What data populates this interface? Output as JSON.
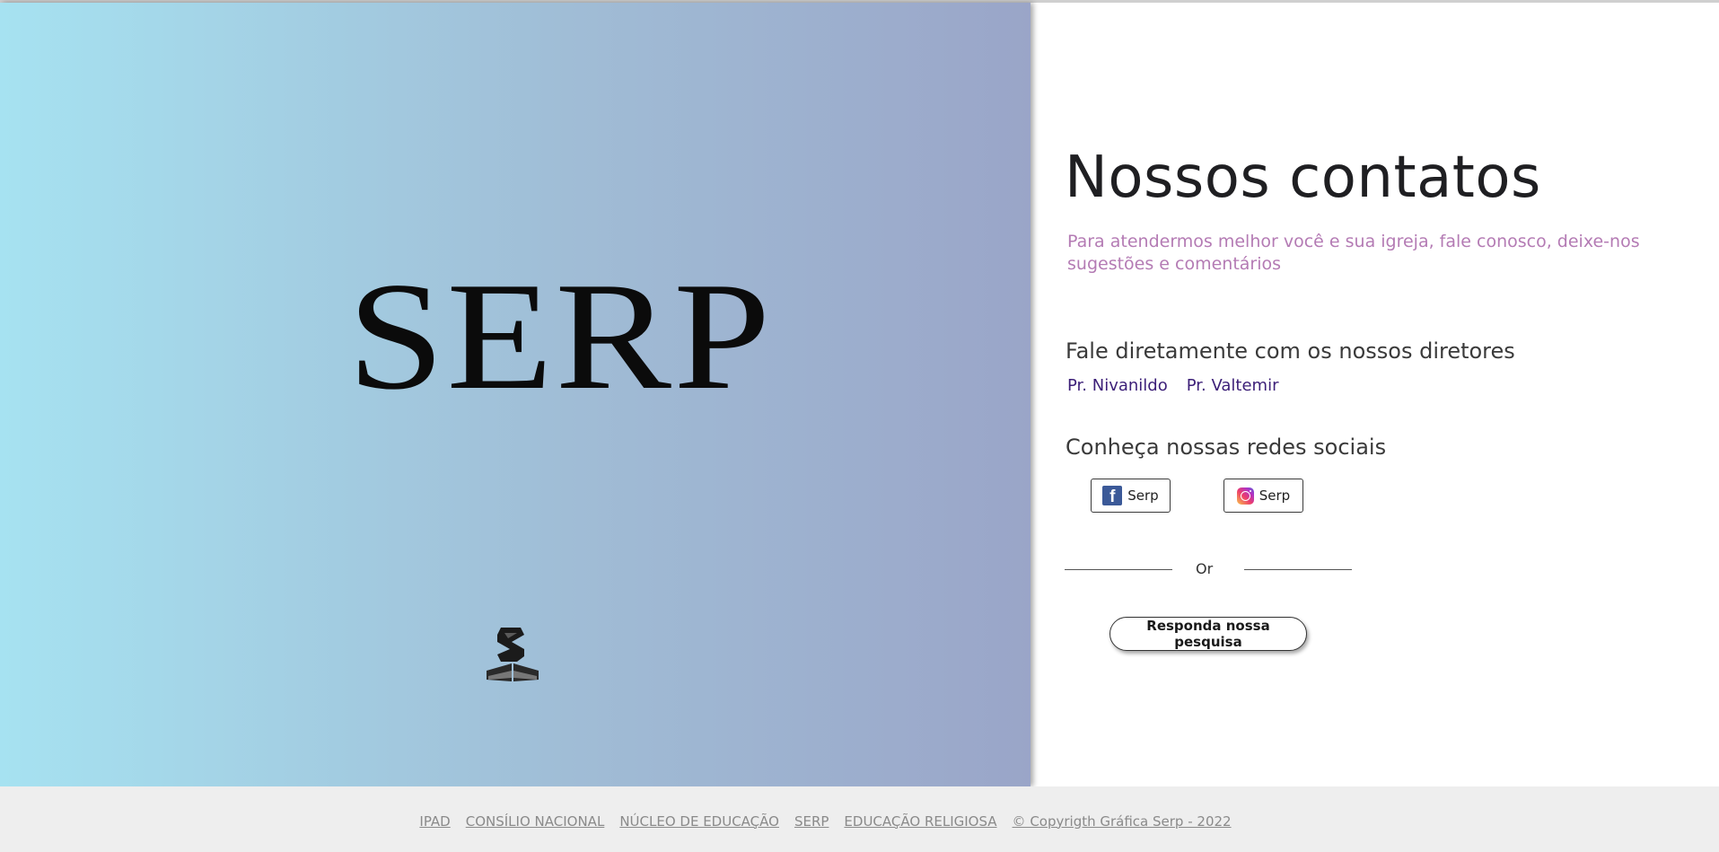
{
  "hero": {
    "brand": "SERP",
    "logo_icon": "serp-book-logo-icon"
  },
  "contact": {
    "title": "Nossos contatos",
    "subtitle": "Para atendermos melhor você e sua igreja, fale conosco, deixe-nos sugestões e comentários",
    "directors_heading": "Fale diretamente com os nossos diretores",
    "directors": [
      "Pr. Nivanildo",
      "Pr. Valtemir"
    ],
    "social_heading": "Conheça nossas redes sociais",
    "social": {
      "facebook_label": "Serp",
      "facebook_icon": "facebook-icon",
      "instagram_label": "Serp",
      "instagram_icon": "instagram-icon"
    },
    "divider_text": "Or",
    "survey_button": "Responda nossa pesquisa"
  },
  "footer": {
    "links": [
      "IPAD",
      "CONSÍLIO NACIONAL",
      "NÚCLEO DE EDUCAÇÃO",
      "SERP",
      "EDUCAÇÃO RELIGIOSA",
      "© Copyrigth Gráfica Serp - 2022"
    ]
  },
  "colors": {
    "gradient_start": "#a6e2f1",
    "gradient_end": "#9aa5c8",
    "subtitle": "#b47bb4",
    "director_link": "#3c1f78",
    "facebook": "#3b5998"
  }
}
